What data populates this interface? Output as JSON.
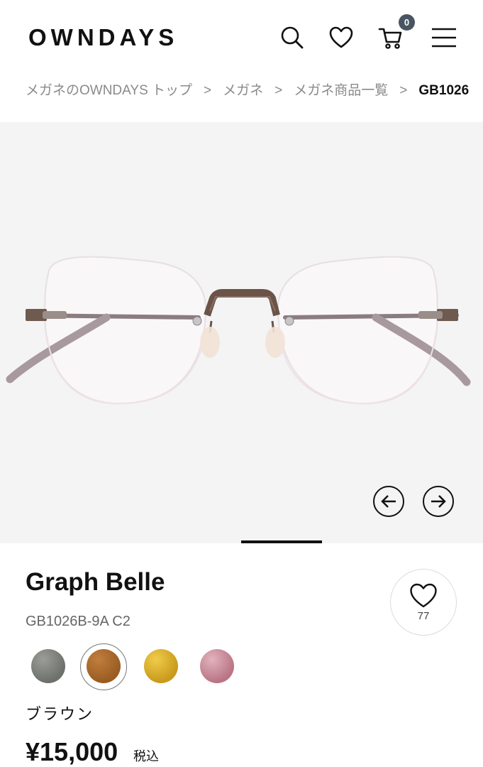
{
  "header": {
    "logo": "OWNDAYS",
    "icons": [
      "search-icon",
      "heart-icon",
      "cart-icon",
      "menu-icon"
    ],
    "cart_count": "0"
  },
  "breadcrumb": {
    "items": [
      "メガネのOWNDAYS トップ",
      "メガネ",
      "メガネ商品一覧",
      "GB1026"
    ],
    "separator": ">"
  },
  "gallery": {
    "image_alt": "rimless eyeglasses brown frame",
    "prev_icon": "arrow-left-icon",
    "next_icon": "arrow-right-icon"
  },
  "product": {
    "name": "Graph Belle",
    "sku": "GB1026B-9A C2",
    "favorite_count": "77",
    "selected_color_name": "ブラウン",
    "price": "¥15,000",
    "tax_label": "税込",
    "colors": [
      {
        "name": "gray",
        "hex": "#7a7d78"
      },
      {
        "name": "brown",
        "hex": "#a8682c",
        "selected": true
      },
      {
        "name": "gold",
        "hex": "#dcb12d"
      },
      {
        "name": "pink",
        "hex": "#c88a98"
      }
    ]
  }
}
